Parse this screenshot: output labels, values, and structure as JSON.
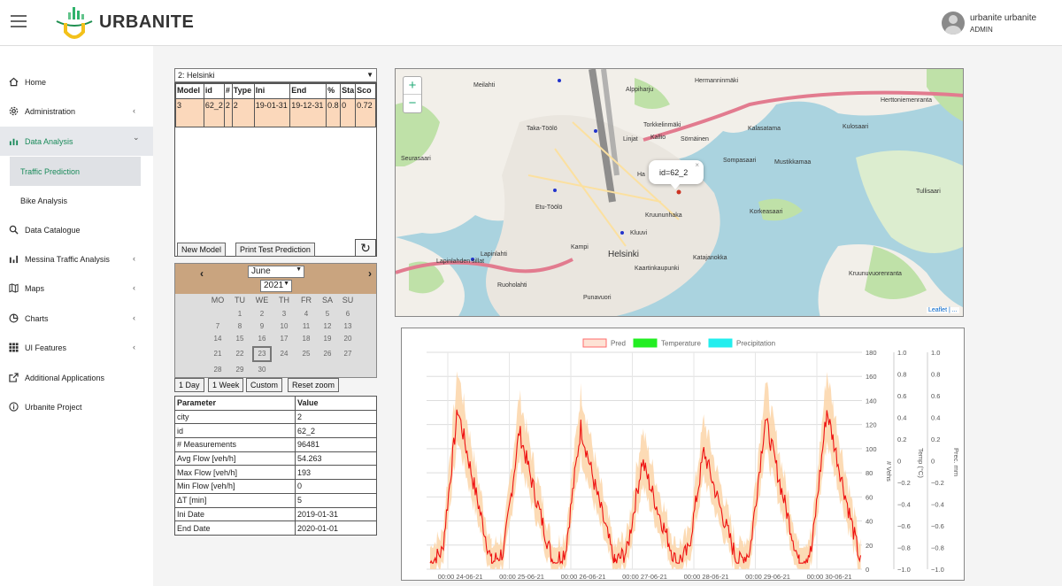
{
  "header": {
    "brand": "URBANITE",
    "user_name": "urbanite urbanite",
    "user_role": "ADMIN"
  },
  "sidebar": {
    "items": [
      {
        "label": "Home",
        "icon": "home-icon",
        "chevron": ""
      },
      {
        "label": "Administration",
        "icon": "gear-icon",
        "chevron": "‹"
      },
      {
        "label": "Data Analysis",
        "icon": "bar-chart-icon",
        "chevron": "⌄"
      },
      {
        "label": "Data Catalogue",
        "icon": "search-icon",
        "chevron": ""
      },
      {
        "label": "Messina Traffic Analysis",
        "icon": "bar-chart-icon",
        "chevron": "‹"
      },
      {
        "label": "Maps",
        "icon": "map-icon",
        "chevron": "‹"
      },
      {
        "label": "Charts",
        "icon": "pie-chart-icon",
        "chevron": "‹"
      },
      {
        "label": "UI Features",
        "icon": "grid-icon",
        "chevron": "‹"
      },
      {
        "label": "Additional Applications",
        "icon": "external-link-icon",
        "chevron": ""
      },
      {
        "label": "Urbanite Project",
        "icon": "info-icon",
        "chevron": ""
      }
    ],
    "subitems": [
      {
        "label": "Traffic Prediction"
      },
      {
        "label": "Bike Analysis"
      }
    ]
  },
  "city_select": {
    "value": "2: Helsinki"
  },
  "models_table": {
    "headers": [
      "Model",
      "id",
      "#",
      "Type",
      "Ini",
      "End",
      "%",
      "Sta",
      "Sco"
    ],
    "row": [
      "3",
      "62_2",
      "2",
      "2",
      "19-01-31",
      "19-12-31",
      "0.8",
      "0",
      "0.72"
    ]
  },
  "buttons": {
    "new_model": "New Model",
    "print_test": "Print Test Prediction",
    "refresh": "↻",
    "one_day": "1 Day",
    "one_week": "1 Week",
    "custom": "Custom",
    "reset_zoom": "Reset zoom"
  },
  "calendar": {
    "prev": "‹",
    "next": "›",
    "month": "June",
    "year": "2021",
    "dow": [
      "MO",
      "TU",
      "WE",
      "TH",
      "FR",
      "SA",
      "SU"
    ],
    "days": [
      "1",
      "2",
      "3",
      "4",
      "5",
      "6",
      "7",
      "8",
      "9",
      "10",
      "11",
      "12",
      "13",
      "14",
      "15",
      "16",
      "17",
      "18",
      "19",
      "20",
      "21",
      "22",
      "23",
      "24",
      "25",
      "26",
      "27",
      "28",
      "29",
      "30"
    ],
    "selected_day": "23"
  },
  "params_table": {
    "headers": [
      "Parameter",
      "Value"
    ],
    "rows": [
      [
        "city",
        "2"
      ],
      [
        "id",
        "62_2"
      ],
      [
        "# Measurements",
        "96481"
      ],
      [
        "Avg Flow [veh/h]",
        "54.263"
      ],
      [
        "Max Flow [veh/h]",
        "193"
      ],
      [
        "Min Flow [veh/h]",
        "0"
      ],
      [
        "ΔT [min]",
        "5"
      ],
      [
        "Ini Date",
        "2019-01-31"
      ],
      [
        "End Date",
        "2020-01-01"
      ]
    ]
  },
  "map": {
    "zoom_in": "+",
    "zoom_out": "−",
    "popup_text": "id=62_2",
    "popup_close": "×",
    "attribution": "Leaflet | ...",
    "labels": [
      "Meilahti",
      "Alppiharju",
      "Hermanninmäki",
      "Herttoniemenranta",
      "Taka-Töölö",
      "Torkkelinmäki",
      "Kallio",
      "Sörnäinen",
      "Kalasatama",
      "Kulosaari",
      "Linjat",
      "Etu-Töölö",
      "Kruununhaka",
      "Sompasaari",
      "Mustikkamaa",
      "Tullisaari",
      "Kluuvi",
      "Kampi",
      "Helsinki",
      "Kaartinkaupunki",
      "Katajanokka",
      "Lapinlahti",
      "Ruoholahti",
      "Punavuori",
      "Seurasaari",
      "Korkeasaari",
      "Ha",
      "Kruunuvuorenranta",
      "Lapinlahden sillat"
    ]
  },
  "chart_data": {
    "type": "line",
    "legend": [
      "Pred",
      "Temperature",
      "Precipitation"
    ],
    "legend_colors": [
      "#ff6b6b",
      "#22ee22",
      "#22eeee"
    ],
    "x_ticks": [
      "00:00 24-06-21",
      "00:00 25-06-21",
      "00:00 26-06-21",
      "00:00 27-06-21",
      "00:00 28-06-21",
      "00:00 29-06-21",
      "00:00 30-06-21"
    ],
    "y_left_label": "# Vehs",
    "y_left_ticks": [
      "0",
      "20",
      "40",
      "60",
      "80",
      "100",
      "120",
      "140",
      "160",
      "180"
    ],
    "ylim": [
      0,
      180
    ],
    "y_temp_label": "Temp (°C)",
    "y_temp_ticks": [
      "−1.0",
      "−0.8",
      "−0.6",
      "−0.4",
      "−0.2",
      "0",
      "0.2",
      "0.4",
      "0.6",
      "0.8",
      "1.0"
    ],
    "y_prec_label": "Prec. mm",
    "y_prec_ticks": [
      "−1.0",
      "−0.8",
      "−0.6",
      "−0.4",
      "−0.2",
      "0",
      "0.2",
      "0.4",
      "0.6",
      "0.8",
      "1.0"
    ],
    "day_peaks": [
      133,
      115,
      118,
      90,
      98,
      125,
      132
    ],
    "min_value": 5,
    "colors": {
      "line": "#ee1111",
      "band": "#fbd5a8"
    }
  }
}
